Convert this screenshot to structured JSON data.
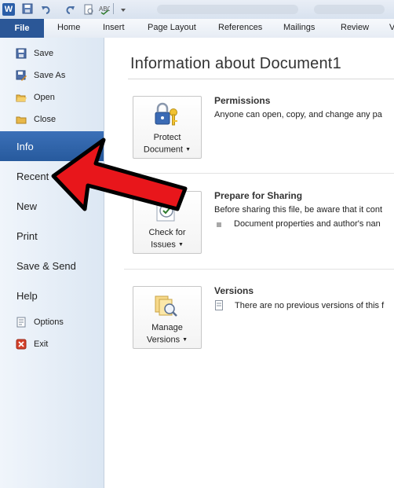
{
  "app": {
    "logo_letter": "W"
  },
  "quick_access": [
    "save-icon",
    "undo-icon",
    "redo-icon",
    "print-preview-icon",
    "spelling-icon",
    "customize-icon"
  ],
  "ribbon": {
    "file_tab": "File",
    "tabs": [
      "Home",
      "Insert",
      "Page Layout",
      "References",
      "Mailings",
      "Review",
      "V"
    ]
  },
  "backstage": {
    "commands": [
      "Save",
      "Save As",
      "Open",
      "Close"
    ],
    "items": [
      "Info",
      "Recent",
      "New",
      "Print",
      "Save & Send",
      "Help"
    ],
    "bottom_commands": [
      "Options",
      "Exit"
    ],
    "active_item": "Info"
  },
  "main": {
    "title": "Information about Document1",
    "permissions": {
      "title": "Permissions",
      "desc": "Anyone can open, copy, and change any pa",
      "button_line1": "Protect",
      "button_line2": "Document"
    },
    "sharing": {
      "title": "Prepare for Sharing",
      "desc": "Before sharing this file, be aware that it cont",
      "bullet": "Document properties and author's nan",
      "button_line1": "Check for",
      "button_line2": "Issues"
    },
    "versions": {
      "title": "Versions",
      "desc": "There are no previous versions of this f",
      "button_line1": "Manage",
      "button_line2": "Versions"
    }
  },
  "colors": {
    "file_tab": "#2b5797",
    "active_nav": "#2f64aa",
    "arrow": "#e8161b"
  }
}
